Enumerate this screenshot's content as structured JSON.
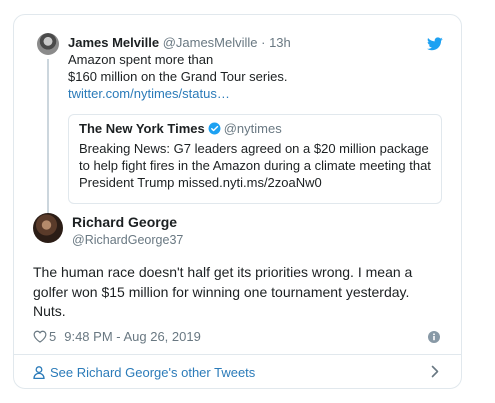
{
  "context": {
    "name": "James Melville",
    "handle": "@JamesMelville",
    "time": "· 13h",
    "text_line1": "Amazon spent more than",
    "text_line2": "$160 million on the Grand Tour series.",
    "link": "twitter.com/nytimes/status…"
  },
  "quote": {
    "name": "The New York Times",
    "handle": "@nytimes",
    "text": "Breaking News: G7 leaders agreed on a $20 million package to help fight fires in the Amazon during a climate meeting that President Trump missed.nyti.ms/2zoaNw0"
  },
  "tweet": {
    "name": "Richard George",
    "handle": "@RichardGeorge37",
    "text": "The human race doesn't half get its priorities wrong. I mean a golfer won $15 million for winning one tournament yesterday. Nuts.",
    "likes": "5",
    "timestamp": "9:48 PM - Aug 26, 2019"
  },
  "footer": {
    "link": "See Richard George's other Tweets"
  },
  "colors": {
    "accent": "#1da1f2",
    "link": "#2b7bb9",
    "muted": "#697882"
  },
  "icons": [
    "twitter-bird-icon",
    "verified-badge-icon",
    "heart-icon",
    "info-icon",
    "person-icon",
    "chevron-right-icon"
  ]
}
